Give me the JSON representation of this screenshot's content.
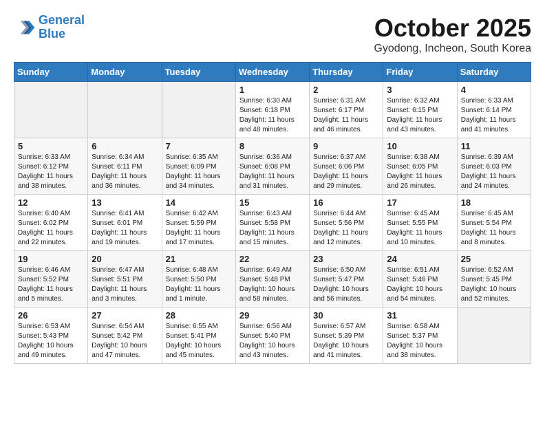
{
  "header": {
    "logo_line1": "General",
    "logo_line2": "Blue",
    "month": "October 2025",
    "location": "Gyodong, Incheon, South Korea"
  },
  "weekdays": [
    "Sunday",
    "Monday",
    "Tuesday",
    "Wednesday",
    "Thursday",
    "Friday",
    "Saturday"
  ],
  "weeks": [
    [
      {
        "day": "",
        "info": ""
      },
      {
        "day": "",
        "info": ""
      },
      {
        "day": "",
        "info": ""
      },
      {
        "day": "1",
        "info": "Sunrise: 6:30 AM\nSunset: 6:18 PM\nDaylight: 11 hours\nand 48 minutes."
      },
      {
        "day": "2",
        "info": "Sunrise: 6:31 AM\nSunset: 6:17 PM\nDaylight: 11 hours\nand 46 minutes."
      },
      {
        "day": "3",
        "info": "Sunrise: 6:32 AM\nSunset: 6:15 PM\nDaylight: 11 hours\nand 43 minutes."
      },
      {
        "day": "4",
        "info": "Sunrise: 6:33 AM\nSunset: 6:14 PM\nDaylight: 11 hours\nand 41 minutes."
      }
    ],
    [
      {
        "day": "5",
        "info": "Sunrise: 6:33 AM\nSunset: 6:12 PM\nDaylight: 11 hours\nand 38 minutes."
      },
      {
        "day": "6",
        "info": "Sunrise: 6:34 AM\nSunset: 6:11 PM\nDaylight: 11 hours\nand 36 minutes."
      },
      {
        "day": "7",
        "info": "Sunrise: 6:35 AM\nSunset: 6:09 PM\nDaylight: 11 hours\nand 34 minutes."
      },
      {
        "day": "8",
        "info": "Sunrise: 6:36 AM\nSunset: 6:08 PM\nDaylight: 11 hours\nand 31 minutes."
      },
      {
        "day": "9",
        "info": "Sunrise: 6:37 AM\nSunset: 6:06 PM\nDaylight: 11 hours\nand 29 minutes."
      },
      {
        "day": "10",
        "info": "Sunrise: 6:38 AM\nSunset: 6:05 PM\nDaylight: 11 hours\nand 26 minutes."
      },
      {
        "day": "11",
        "info": "Sunrise: 6:39 AM\nSunset: 6:03 PM\nDaylight: 11 hours\nand 24 minutes."
      }
    ],
    [
      {
        "day": "12",
        "info": "Sunrise: 6:40 AM\nSunset: 6:02 PM\nDaylight: 11 hours\nand 22 minutes."
      },
      {
        "day": "13",
        "info": "Sunrise: 6:41 AM\nSunset: 6:01 PM\nDaylight: 11 hours\nand 19 minutes."
      },
      {
        "day": "14",
        "info": "Sunrise: 6:42 AM\nSunset: 5:59 PM\nDaylight: 11 hours\nand 17 minutes."
      },
      {
        "day": "15",
        "info": "Sunrise: 6:43 AM\nSunset: 5:58 PM\nDaylight: 11 hours\nand 15 minutes."
      },
      {
        "day": "16",
        "info": "Sunrise: 6:44 AM\nSunset: 5:56 PM\nDaylight: 11 hours\nand 12 minutes."
      },
      {
        "day": "17",
        "info": "Sunrise: 6:45 AM\nSunset: 5:55 PM\nDaylight: 11 hours\nand 10 minutes."
      },
      {
        "day": "18",
        "info": "Sunrise: 6:45 AM\nSunset: 5:54 PM\nDaylight: 11 hours\nand 8 minutes."
      }
    ],
    [
      {
        "day": "19",
        "info": "Sunrise: 6:46 AM\nSunset: 5:52 PM\nDaylight: 11 hours\nand 5 minutes."
      },
      {
        "day": "20",
        "info": "Sunrise: 6:47 AM\nSunset: 5:51 PM\nDaylight: 11 hours\nand 3 minutes."
      },
      {
        "day": "21",
        "info": "Sunrise: 6:48 AM\nSunset: 5:50 PM\nDaylight: 11 hours\nand 1 minute."
      },
      {
        "day": "22",
        "info": "Sunrise: 6:49 AM\nSunset: 5:48 PM\nDaylight: 10 hours\nand 58 minutes."
      },
      {
        "day": "23",
        "info": "Sunrise: 6:50 AM\nSunset: 5:47 PM\nDaylight: 10 hours\nand 56 minutes."
      },
      {
        "day": "24",
        "info": "Sunrise: 6:51 AM\nSunset: 5:46 PM\nDaylight: 10 hours\nand 54 minutes."
      },
      {
        "day": "25",
        "info": "Sunrise: 6:52 AM\nSunset: 5:45 PM\nDaylight: 10 hours\nand 52 minutes."
      }
    ],
    [
      {
        "day": "26",
        "info": "Sunrise: 6:53 AM\nSunset: 5:43 PM\nDaylight: 10 hours\nand 49 minutes."
      },
      {
        "day": "27",
        "info": "Sunrise: 6:54 AM\nSunset: 5:42 PM\nDaylight: 10 hours\nand 47 minutes."
      },
      {
        "day": "28",
        "info": "Sunrise: 6:55 AM\nSunset: 5:41 PM\nDaylight: 10 hours\nand 45 minutes."
      },
      {
        "day": "29",
        "info": "Sunrise: 6:56 AM\nSunset: 5:40 PM\nDaylight: 10 hours\nand 43 minutes."
      },
      {
        "day": "30",
        "info": "Sunrise: 6:57 AM\nSunset: 5:39 PM\nDaylight: 10 hours\nand 41 minutes."
      },
      {
        "day": "31",
        "info": "Sunrise: 6:58 AM\nSunset: 5:37 PM\nDaylight: 10 hours\nand 38 minutes."
      },
      {
        "day": "",
        "info": ""
      }
    ]
  ]
}
